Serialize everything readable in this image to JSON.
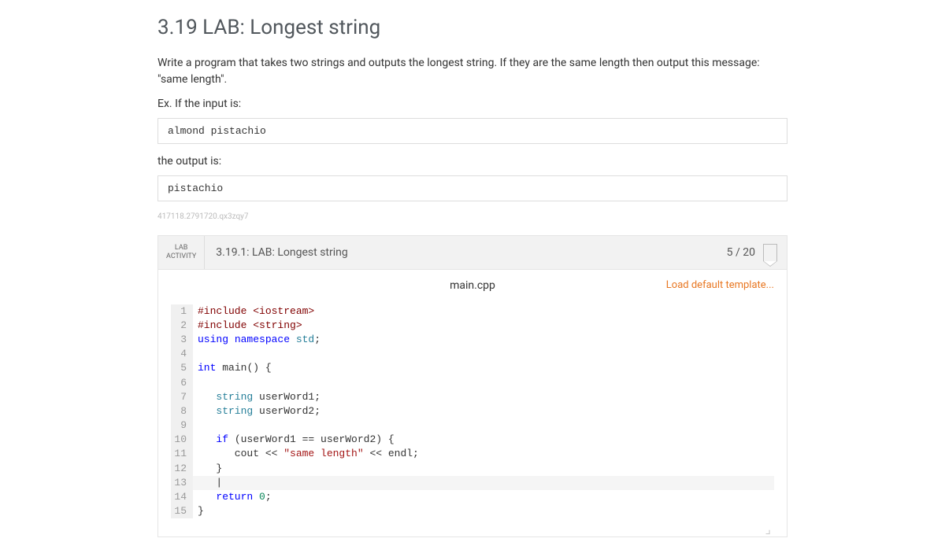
{
  "page": {
    "title": "3.19 LAB: Longest string",
    "description": "Write a program that takes two strings and outputs the longest string. If they are the same length then output this message: \"same length\".",
    "example_label": "Ex. If the input is:",
    "example_input": "almond pistachio",
    "output_label": "the output is:",
    "example_output": "pistachio",
    "watermark": "417118.2791720.qx3zqy7"
  },
  "lab": {
    "badge_line1": "LAB",
    "badge_line2": "ACTIVITY",
    "title": "3.19.1: LAB: Longest string",
    "score": "5 / 20"
  },
  "editor": {
    "filename": "main.cpp",
    "load_template": "Load default template...",
    "code": [
      {
        "n": "1",
        "tokens": [
          {
            "t": "#include ",
            "c": "inc"
          },
          {
            "t": "<iostream>",
            "c": "inc"
          }
        ]
      },
      {
        "n": "2",
        "tokens": [
          {
            "t": "#include ",
            "c": "inc"
          },
          {
            "t": "<string>",
            "c": "inc"
          }
        ]
      },
      {
        "n": "3",
        "tokens": [
          {
            "t": "using ",
            "c": "kw"
          },
          {
            "t": "namespace ",
            "c": "kw"
          },
          {
            "t": "std",
            "c": "ns"
          },
          {
            "t": ";",
            "c": ""
          }
        ]
      },
      {
        "n": "4",
        "tokens": []
      },
      {
        "n": "5",
        "tokens": [
          {
            "t": "int ",
            "c": "kw"
          },
          {
            "t": "main",
            "c": ""
          },
          {
            "t": "() {",
            "c": ""
          }
        ]
      },
      {
        "n": "6",
        "tokens": []
      },
      {
        "n": "7",
        "tokens": [
          {
            "t": "   string ",
            "c": "type"
          },
          {
            "t": "userWord1;",
            "c": ""
          }
        ]
      },
      {
        "n": "8",
        "tokens": [
          {
            "t": "   string ",
            "c": "type"
          },
          {
            "t": "userWord2;",
            "c": ""
          }
        ]
      },
      {
        "n": "9",
        "tokens": []
      },
      {
        "n": "10",
        "tokens": [
          {
            "t": "   if ",
            "c": "kw"
          },
          {
            "t": "(userWord1 == userWord2) {",
            "c": ""
          }
        ]
      },
      {
        "n": "11",
        "tokens": [
          {
            "t": "      cout << ",
            "c": ""
          },
          {
            "t": "\"same length\"",
            "c": "str"
          },
          {
            "t": " << endl;",
            "c": ""
          }
        ]
      },
      {
        "n": "12",
        "tokens": [
          {
            "t": "   }",
            "c": ""
          }
        ]
      },
      {
        "n": "13",
        "highlight": true,
        "tokens": [
          {
            "t": "   |",
            "c": ""
          }
        ]
      },
      {
        "n": "14",
        "tokens": [
          {
            "t": "   return ",
            "c": "kw"
          },
          {
            "t": "0",
            "c": "num"
          },
          {
            "t": ";",
            "c": ""
          }
        ]
      },
      {
        "n": "15",
        "tokens": [
          {
            "t": "}",
            "c": ""
          }
        ]
      }
    ]
  }
}
